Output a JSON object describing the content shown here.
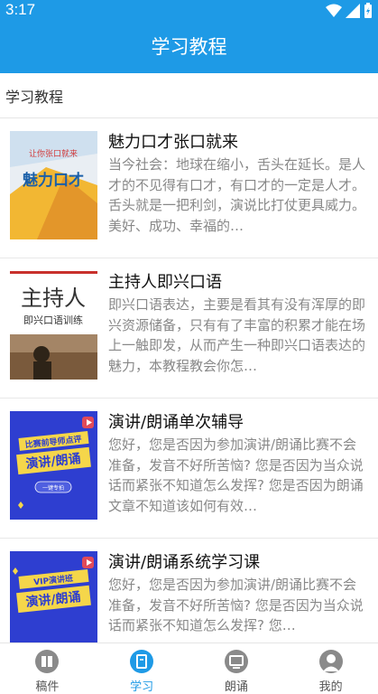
{
  "status": {
    "time": "3:17"
  },
  "appbar": {
    "title": "学习教程"
  },
  "subheader": {
    "label": "学习教程"
  },
  "items": [
    {
      "title": "魅力口才张口就来",
      "desc": "当今社会：地球在缩小，舌头在延长。是人才的不见得有口才，有口才的一定是人才。 舌头就是一把利剑，演说比打仗更具威力。 美好、成功、幸福的…",
      "thumb_top": "让你张口就来",
      "thumb_main": "魅力口才"
    },
    {
      "title": "主持人即兴口语",
      "desc": "即兴口语表达，主要是看其有没有浑厚的即兴资源储备，只有有了丰富的积累才能在场上一触即发，从而产生一种即兴口语表达的魅力，本教程教会你怎…",
      "thumb_main": "主持人",
      "thumb_sub": "即兴口语训练"
    },
    {
      "title": "演讲/朗诵单次辅导",
      "desc": "您好，您是否因为参加演讲/朗诵比赛不会准备，发音不好所苦恼? 您是否因为当众说话而紧张不知道怎么发挥? 您是否因为朗诵文章不知道该如何有效…",
      "thumb_top": "比赛前导师点评",
      "thumb_main": "演讲/朗诵",
      "thumb_btn": "一键专拍"
    },
    {
      "title": "演讲/朗诵系统学习课",
      "desc": "您好，您是否因为参加演讲/朗诵比赛不会准备，发音不好所苦恼? 您是否因为当众说话而紧张不知道怎么发挥? 您…",
      "thumb_top": "VIP演讲班",
      "thumb_main": "演讲/朗诵"
    }
  ],
  "nav": [
    {
      "label": "稿件",
      "icon": "book-icon",
      "active": false
    },
    {
      "label": "学习",
      "icon": "study-icon",
      "active": true
    },
    {
      "label": "朗诵",
      "icon": "recite-icon",
      "active": false
    },
    {
      "label": "我的",
      "icon": "user-icon",
      "active": false
    }
  ]
}
